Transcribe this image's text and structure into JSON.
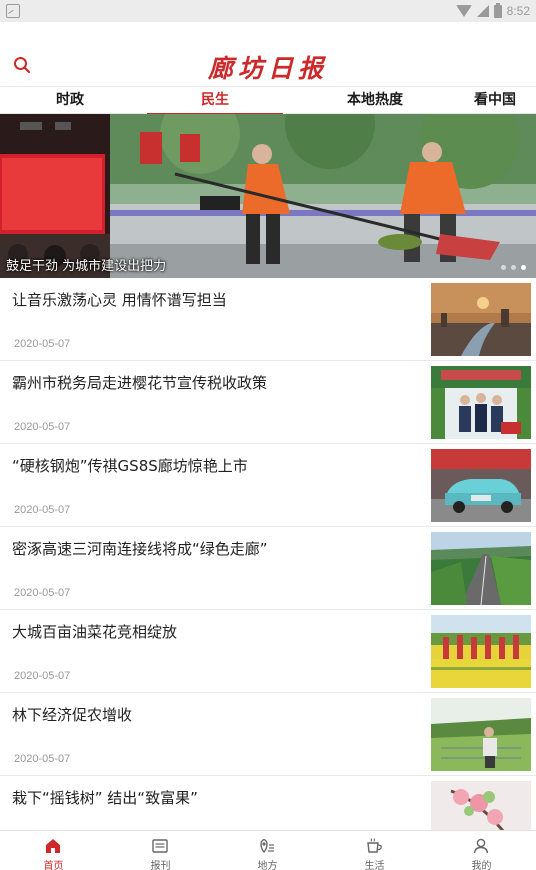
{
  "status_bar": {
    "time": "8:52"
  },
  "header": {
    "logo_text": "廊坊日报",
    "search_icon": "search-icon"
  },
  "tabs": [
    {
      "label": "时政",
      "active": false
    },
    {
      "label": "民生",
      "active": true
    },
    {
      "label": "本地热度",
      "active": false
    },
    {
      "label": "看中国",
      "active": false
    }
  ],
  "banner": {
    "caption": "鼓足干劲 为城市建设出把力"
  },
  "news": [
    {
      "title": "让音乐激荡心灵 用情怀谱写担当",
      "date": "2020-05-07"
    },
    {
      "title": "霸州市税务局走进樱花节宣传税收政策",
      "date": "2020-05-07"
    },
    {
      "title": "“硬核钢炮”传祺GS8S廊坊惊艳上市",
      "date": "2020-05-07"
    },
    {
      "title": "密涿高速三河南连接线将成“绿色走廊”",
      "date": "2020-05-07"
    },
    {
      "title": "大城百亩油菜花竞相绽放",
      "date": "2020-05-07"
    },
    {
      "title": "林下经济促农增收",
      "date": "2020-05-07"
    },
    {
      "title": "栽下“摇钱树” 结出“致富果”",
      "date": ""
    }
  ],
  "bottom_nav": [
    {
      "label": "首页",
      "icon": "home-icon",
      "active": true
    },
    {
      "label": "报刊",
      "icon": "newspaper-icon",
      "active": false
    },
    {
      "label": "地方",
      "icon": "location-icon",
      "active": false
    },
    {
      "label": "生活",
      "icon": "cup-icon",
      "active": false
    },
    {
      "label": "我的",
      "icon": "user-icon",
      "active": false
    }
  ],
  "colors": {
    "brand": "#cc2a2a",
    "text": "#222222",
    "muted": "#999999"
  }
}
